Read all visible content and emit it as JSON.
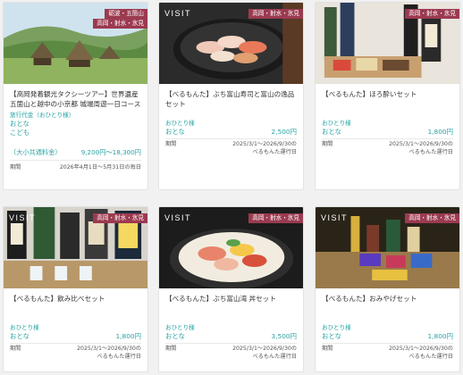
{
  "cards": [
    {
      "area_tags": [
        "砺波・五箇山",
        "高岡・射水・氷見"
      ],
      "visit": "",
      "title": "【高岡発着観光タクシーツアー】世界遺産 五箇山と越中の小京都 城端周遊一日コース",
      "label": "旅行代金（おひとり様）",
      "rows": [
        {
          "name": "おとな",
          "price": ""
        },
        {
          "name": "こども",
          "price": ""
        }
      ],
      "fee": {
        "name": "（大小共通料金）",
        "price": "9,200円～18,300円"
      },
      "period_label": "期間",
      "period_text": "2026年4月1日～5月31日の毎日"
    },
    {
      "area_tags": [
        "高岡・射水・氷見"
      ],
      "visit": "VISIT",
      "title": "【べるもんた】ぶち富山寿司と富山の逸品セット",
      "label": "おひとり様",
      "rows": [
        {
          "name": "おとな",
          "price": "2,500円"
        }
      ],
      "period_label": "期間",
      "period_text": "2025/3/1～2026/9/30の\nべるもんた運行日"
    },
    {
      "area_tags": [
        "高岡・射水・氷見"
      ],
      "visit": "",
      "title": "【べるもんた】ほろ酔いセット",
      "label": "おひとり様",
      "rows": [
        {
          "name": "おとな",
          "price": "1,800円"
        }
      ],
      "period_label": "期間",
      "period_text": "2025/3/1～2026/9/30の\nべるもんた運行日"
    },
    {
      "area_tags": [
        "高岡・射水・氷見"
      ],
      "visit": "VISIT",
      "title": "【べるもんた】飲み比べセット",
      "label": "おひとり様",
      "rows": [
        {
          "name": "おとな",
          "price": "1,800円"
        }
      ],
      "period_label": "期間",
      "period_text": "2025/3/1～2026/9/30の\nべるもんた運行日"
    },
    {
      "area_tags": [
        "高岡・射水・氷見"
      ],
      "visit": "VISIT",
      "title": "【べるもんた】ぶち富山湾 丼セット",
      "label": "おひとり様",
      "rows": [
        {
          "name": "おとな",
          "price": "3,500円"
        }
      ],
      "period_label": "期間",
      "period_text": "2025/3/1～2026/9/30の\nべるもんた運行日"
    },
    {
      "area_tags": [
        "高岡・射水・氷見"
      ],
      "visit": "VISIT",
      "title": "【べるもんた】おみやげセット",
      "label": "おひとり様",
      "rows": [
        {
          "name": "おとな",
          "price": "1,800円"
        }
      ],
      "period_label": "期間",
      "period_text": "2025/3/1～2026/9/30の\nべるもんた運行日"
    }
  ]
}
